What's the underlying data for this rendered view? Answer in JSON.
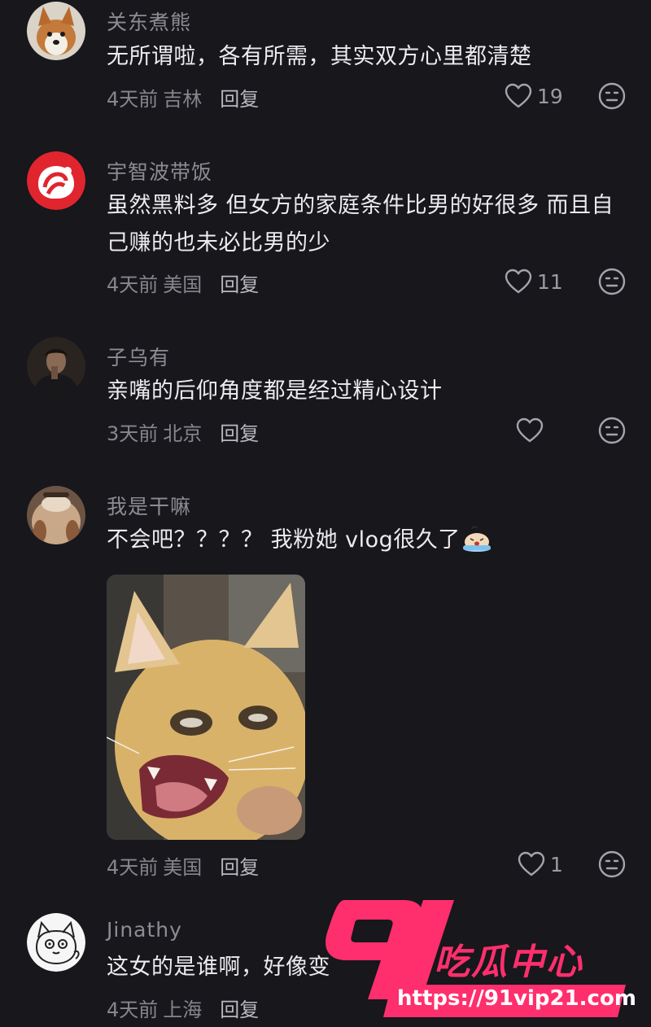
{
  "comments": [
    {
      "username": "关东煮熊",
      "text": "无所谓啦，各有所需，其实双方心里都清楚",
      "time": "4天前",
      "location": "吉林",
      "reply_label": "回复",
      "likes": "19"
    },
    {
      "username": "宇智波带饭",
      "text": "虽然黑料多 但女方的家庭条件比男的好很多 而且自己赚的也未必比男的少",
      "time": "4天前",
      "location": "美国",
      "reply_label": "回复",
      "likes": "11"
    },
    {
      "username": "子乌有",
      "text": "亲嘴的后仰角度都是经过精心设计",
      "time": "3天前",
      "location": "北京",
      "reply_label": "回复",
      "likes": ""
    },
    {
      "username": "我是干嘛",
      "text": "不会吧？？？？ 我粉她 vlog很久了",
      "time": "4天前",
      "location": "美国",
      "reply_label": "回复",
      "likes": "1",
      "has_image": true,
      "inline_emoji": "crying-face-emoji"
    },
    {
      "username": "Jinathy",
      "text": "这女的是谁啊，好像变",
      "time": "4天前",
      "location": "上海",
      "reply_label": "回复",
      "likes": ""
    }
  ],
  "watermark": {
    "number": "91",
    "brand": "吃瓜中心",
    "url": "https://91vip21.com"
  },
  "colors": {
    "background": "#17171c",
    "username": "#8c8c94",
    "text": "#ececee",
    "meta": "#86868e",
    "watermark_pink": "#ff2f6d"
  }
}
